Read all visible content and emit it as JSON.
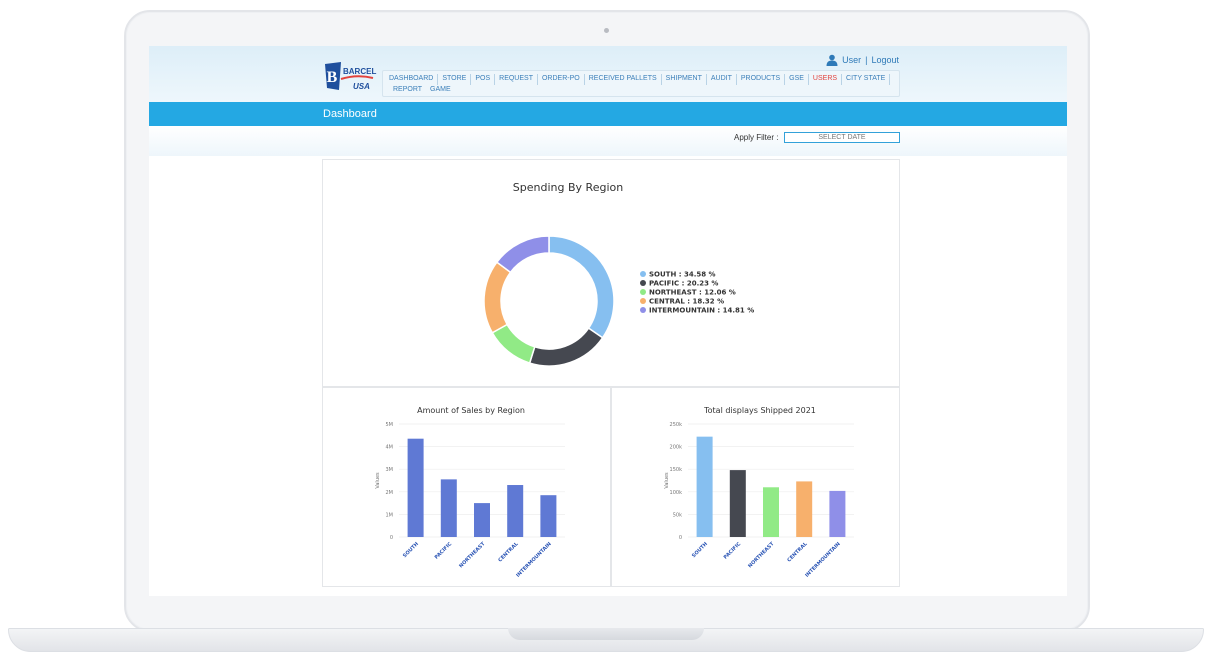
{
  "header": {
    "logo_text": [
      "BARCEL",
      "USA"
    ],
    "user_link": "User",
    "separator": "|",
    "logout_link": "Logout",
    "user_icon": "user-icon"
  },
  "nav": {
    "items": [
      "DASHBOARD",
      "STORE",
      "POS",
      "REQUEST",
      "ORDER-PO",
      "RECEIVED PALLETS",
      "SHIPMENT",
      "AUDIT",
      "PRODUCTS",
      "GSE",
      "USERS",
      "CITY STATE",
      "REPORT",
      "GAME"
    ],
    "active_item": "USERS",
    "active_color": "#e2433d"
  },
  "page": {
    "title": "Dashboard",
    "filter_label": "Apply Filter :",
    "filter_placeholder": "SELECT DATE"
  },
  "colors": {
    "accent": "#24a8e3",
    "south": "#86bff0",
    "pacific": "#454850",
    "northeast": "#91ea86",
    "central": "#f7b06c",
    "intermountain": "#8f8fe8",
    "bar_blue": "#5f79d4"
  },
  "chart_data": [
    {
      "type": "pie",
      "title": "Spending By Region",
      "donut": true,
      "legend_position": "right",
      "slices": [
        {
          "label": "SOUTH",
          "value": 34.58,
          "legend": "SOUTH : 34.58 %",
          "color": "#86bff0"
        },
        {
          "label": "PACIFIC",
          "value": 20.23,
          "legend": "PACIFIC : 20.23 %",
          "color": "#454850"
        },
        {
          "label": "NORTHEAST",
          "value": 12.06,
          "legend": "NORTHEAST : 12.06 %",
          "color": "#91ea86"
        },
        {
          "label": "CENTRAL",
          "value": 18.32,
          "legend": "CENTRAL : 18.32 %",
          "color": "#f7b06c"
        },
        {
          "label": "INTERMOUNTAIN",
          "value": 14.81,
          "legend": "INTERMOUNTAIN : 14.81 %",
          "color": "#8f8fe8"
        }
      ]
    },
    {
      "type": "bar",
      "title": "Amount of Sales by Region",
      "ylabel": "Values",
      "categories": [
        "SOUTH",
        "PACIFIC",
        "NORTHEAST",
        "CENTRAL",
        "INTERMOUNTAIN"
      ],
      "values": [
        4350000,
        2550000,
        1500000,
        2300000,
        1850000
      ],
      "colors": [
        "#5f79d4",
        "#5f79d4",
        "#5f79d4",
        "#5f79d4",
        "#5f79d4"
      ],
      "ylim": [
        0,
        5000000
      ],
      "yticks": [
        0,
        1000000,
        2000000,
        3000000,
        4000000,
        5000000
      ],
      "ytick_labels": [
        "0",
        "1M",
        "2M",
        "3M",
        "4M",
        "5M"
      ],
      "grid": true
    },
    {
      "type": "bar",
      "title": "Total displays Shipped 2021",
      "ylabel": "Values",
      "categories": [
        "SOUTH",
        "PACIFIC",
        "NORTHEAST",
        "CENTRAL",
        "INTERMOUNTAIN"
      ],
      "values": [
        222000,
        148000,
        110000,
        123000,
        102000
      ],
      "colors": [
        "#86bff0",
        "#454850",
        "#91ea86",
        "#f7b06c",
        "#8f8fe8"
      ],
      "ylim": [
        0,
        250000
      ],
      "yticks": [
        0,
        50000,
        100000,
        150000,
        200000,
        250000
      ],
      "ytick_labels": [
        "0",
        "50k",
        "100k",
        "150k",
        "200k",
        "250k"
      ],
      "grid": true
    }
  ]
}
